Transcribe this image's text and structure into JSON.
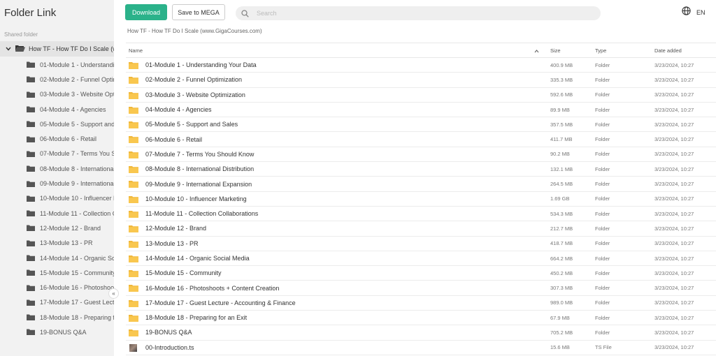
{
  "app": {
    "title": "Folder Link"
  },
  "sidebar": {
    "section_label": "Shared folder",
    "root_label": "How TF - How TF Do I Scale (www.GigaCourses.com)",
    "collapse_glyph": "«",
    "items": [
      "01-Module 1 - Understanding Your Data",
      "02-Module 2 - Funnel Optimization",
      "03-Module 3 - Website Optimization",
      "04-Module 4 - Agencies",
      "05-Module 5 - Support and Sales",
      "06-Module 6 - Retail",
      "07-Module 7 - Terms You Should Know",
      "08-Module 8 - International Distribution",
      "09-Module 9 - International Expansion",
      "10-Module 10 - Influencer Marketing",
      "11-Module 11 - Collection Collaborations",
      "12-Module 12 - Brand",
      "13-Module 13 - PR",
      "14-Module 14 - Organic Social Media",
      "15-Module 15 - Community",
      "16-Module 16 - Photoshoots + Content Creation",
      "17-Module 17 - Guest Lecture - Accounting & Finance",
      "18-Module 18 - Preparing for an Exit",
      "19-BONUS Q&A"
    ]
  },
  "toolbar": {
    "download_label": "Download",
    "save_label": "Save to MEGA",
    "search_placeholder": "Search",
    "language": "EN"
  },
  "breadcrumb": "How TF - How TF Do I Scale (www.GigaCourses.com)",
  "table": {
    "headers": {
      "name": "Name",
      "size": "Size",
      "type": "Type",
      "date": "Date added"
    },
    "rows": [
      {
        "name": "01-Module 1 - Understanding Your Data",
        "size": "400.9 MB",
        "type": "Folder",
        "date": "3/23/2024, 10:27"
      },
      {
        "name": "02-Module 2 - Funnel Optimization",
        "size": "335.3 MB",
        "type": "Folder",
        "date": "3/23/2024, 10:27"
      },
      {
        "name": "03-Module 3 - Website Optimization",
        "size": "592.6 MB",
        "type": "Folder",
        "date": "3/23/2024, 10:27"
      },
      {
        "name": "04-Module 4 - Agencies",
        "size": "89.9 MB",
        "type": "Folder",
        "date": "3/23/2024, 10:27"
      },
      {
        "name": "05-Module 5 - Support and Sales",
        "size": "357.5 MB",
        "type": "Folder",
        "date": "3/23/2024, 10:27"
      },
      {
        "name": "06-Module 6 - Retail",
        "size": "411.7 MB",
        "type": "Folder",
        "date": "3/23/2024, 10:27"
      },
      {
        "name": "07-Module 7 - Terms You Should Know",
        "size": "90.2 MB",
        "type": "Folder",
        "date": "3/23/2024, 10:27"
      },
      {
        "name": "08-Module 8 - International Distribution",
        "size": "132.1 MB",
        "type": "Folder",
        "date": "3/23/2024, 10:27"
      },
      {
        "name": "09-Module 9 - International Expansion",
        "size": "264.5 MB",
        "type": "Folder",
        "date": "3/23/2024, 10:27"
      },
      {
        "name": "10-Module 10 - Influencer Marketing",
        "size": "1.69 GB",
        "type": "Folder",
        "date": "3/23/2024, 10:27"
      },
      {
        "name": "11-Module 11 - Collection Collaborations",
        "size": "534.3 MB",
        "type": "Folder",
        "date": "3/23/2024, 10:27"
      },
      {
        "name": "12-Module 12 - Brand",
        "size": "212.7 MB",
        "type": "Folder",
        "date": "3/23/2024, 10:27"
      },
      {
        "name": "13-Module 13 - PR",
        "size": "418.7 MB",
        "type": "Folder",
        "date": "3/23/2024, 10:27"
      },
      {
        "name": "14-Module 14 - Organic Social Media",
        "size": "664.2 MB",
        "type": "Folder",
        "date": "3/23/2024, 10:27"
      },
      {
        "name": "15-Module 15 - Community",
        "size": "450.2 MB",
        "type": "Folder",
        "date": "3/23/2024, 10:27"
      },
      {
        "name": "16-Module 16 - Photoshoots + Content Creation",
        "size": "307.3 MB",
        "type": "Folder",
        "date": "3/23/2024, 10:27"
      },
      {
        "name": "17-Module 17 - Guest Lecture - Accounting & Finance",
        "size": "989.0 MB",
        "type": "Folder",
        "date": "3/23/2024, 10:27"
      },
      {
        "name": "18-Module 18 - Preparing for an Exit",
        "size": "67.9 MB",
        "type": "Folder",
        "date": "3/23/2024, 10:27"
      },
      {
        "name": "19-BONUS Q&A",
        "size": "705.2 MB",
        "type": "Folder",
        "date": "3/23/2024, 10:27"
      },
      {
        "name": "00-Introduction.ts",
        "size": "15.6 MB",
        "type": "TS File",
        "date": "3/23/2024, 10:27",
        "icon": "video-thumbnail"
      }
    ]
  },
  "colors": {
    "accent": "#2bb28a",
    "folder_yellow": "#f9c74f",
    "folder_dark": "#555555",
    "sidebar_bg": "#f2f2f2"
  }
}
